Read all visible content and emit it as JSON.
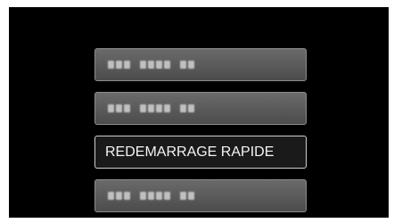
{
  "menu": {
    "items": [
      {
        "label": "",
        "selected": false
      },
      {
        "label": "",
        "selected": false
      },
      {
        "label": "REDEMARRAGE RAPIDE",
        "selected": true
      },
      {
        "label": "",
        "selected": false
      }
    ]
  }
}
